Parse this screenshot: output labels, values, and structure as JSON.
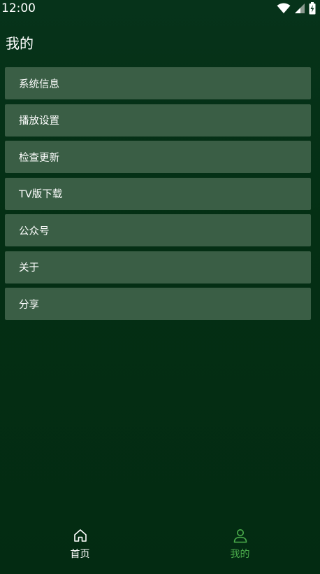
{
  "status_bar": {
    "time": "12:00",
    "icons": [
      "wifi-icon",
      "signal-icon",
      "battery-icon"
    ]
  },
  "page": {
    "title": "我的"
  },
  "menu": {
    "items": [
      {
        "label": "系统信息"
      },
      {
        "label": "播放设置"
      },
      {
        "label": "检查更新"
      },
      {
        "label": "TV版下载"
      },
      {
        "label": "公众号"
      },
      {
        "label": "关于"
      },
      {
        "label": "分享"
      }
    ]
  },
  "bottom_nav": {
    "items": [
      {
        "label": "首页",
        "icon": "home-icon",
        "active": false
      },
      {
        "label": "我的",
        "icon": "person-icon",
        "active": true
      }
    ]
  },
  "colors": {
    "background": "#04301a",
    "menu_item_bg": "#3a5e45",
    "active_accent": "#4cae4c",
    "text": "#ffffff"
  }
}
